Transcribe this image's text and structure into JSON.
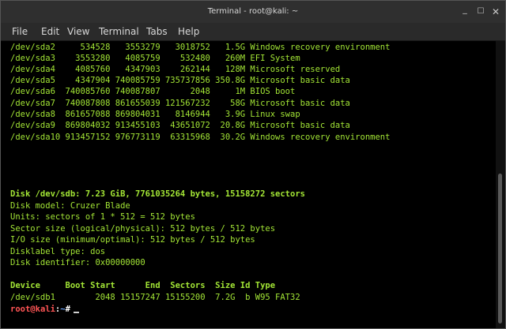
{
  "window": {
    "title": "Terminal - root@kali: ~",
    "min_glyph": "_",
    "max_glyph": "☐",
    "close_glyph": "✕"
  },
  "menu": [
    "File",
    "Edit",
    "View",
    "Terminal",
    "Tabs",
    "Help"
  ],
  "partition_rows": [
    "/dev/sda2     534528   3553279   3018752   1.5G Windows recovery environment",
    "/dev/sda3    3553280   4085759    532480   260M EFI System",
    "/dev/sda4    4085760   4347903    262144   128M Microsoft reserved",
    "/dev/sda5    4347904 740085759 735737856 350.8G Microsoft basic data",
    "/dev/sda6  740085760 740087807      2048     1M BIOS boot",
    "/dev/sda7  740087808 861655039 121567232    58G Microsoft basic data",
    "/dev/sda8  861657088 869804031   8146944   3.9G Linux swap",
    "/dev/sda9  869804032 913455103  43651072  20.8G Microsoft basic data",
    "/dev/sda10 913457152 976773119  63315968  30.2G Windows recovery environment"
  ],
  "disk_info": {
    "header": "Disk /dev/sdb: 7.23 GiB, 7761035264 bytes, 15158272 sectors",
    "lines": [
      "Disk model: Cruzer Blade",
      "Units: sectors of 1 * 512 = 512 bytes",
      "Sector size (logical/physical): 512 bytes / 512 bytes",
      "I/O size (minimum/optimal): 512 bytes / 512 bytes",
      "Disklabel type: dos",
      "Disk identifier: 0x00000000"
    ]
  },
  "sdb_table": {
    "header": "Device     Boot Start      End  Sectors  Size Id Type",
    "row": "/dev/sdb1        2048 15157247 15155200  7.2G  b W95 FAT32"
  },
  "prompt": {
    "user": "root",
    "at": "@",
    "host": "kali",
    "sep": ":",
    "path": "~",
    "symbol": "#"
  },
  "colors": {
    "terminal_text": "#a3e635",
    "prompt_user": "#ff5555",
    "prompt_path": "#6fa8ff"
  }
}
